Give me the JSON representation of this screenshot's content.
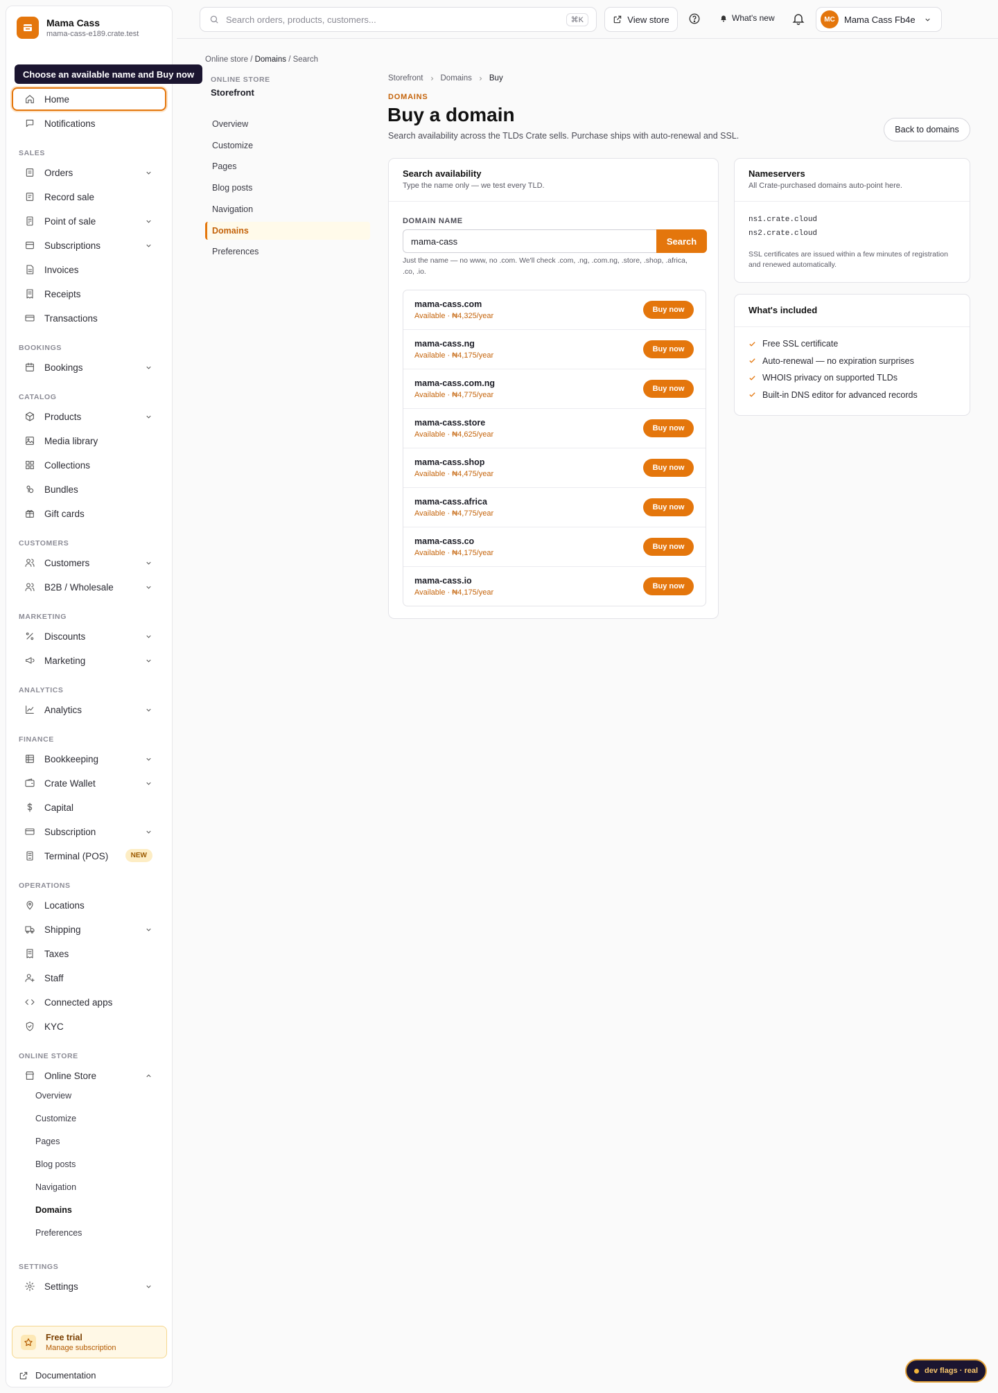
{
  "brand": {
    "name": "Mama Cass",
    "url": "mama-cass-e189.crate.test"
  },
  "tooltip": "Choose an available name and Buy now",
  "sidebar": {
    "top_items": [
      {
        "label": "Home",
        "icon": "home-icon"
      },
      {
        "label": "Notifications",
        "icon": "chat-bubble-icon"
      }
    ],
    "sections": [
      {
        "title": "SALES",
        "items": [
          {
            "label": "Orders",
            "icon": "orders-icon",
            "chevron": true
          },
          {
            "label": "Record sale",
            "icon": "record-sale-icon",
            "chevron": false
          },
          {
            "label": "Point of sale",
            "icon": "pos-icon",
            "chevron": true
          },
          {
            "label": "Subscriptions",
            "icon": "subscriptions-icon",
            "chevron": true
          },
          {
            "label": "Invoices",
            "icon": "invoice-icon",
            "chevron": false
          },
          {
            "label": "Receipts",
            "icon": "receipt-icon",
            "chevron": false
          },
          {
            "label": "Transactions",
            "icon": "card-icon",
            "chevron": false
          }
        ]
      },
      {
        "title": "BOOKINGS",
        "items": [
          {
            "label": "Bookings",
            "icon": "calendar-icon",
            "chevron": true
          }
        ]
      },
      {
        "title": "CATALOG",
        "items": [
          {
            "label": "Products",
            "icon": "box-icon",
            "chevron": true
          },
          {
            "label": "Media library",
            "icon": "image-icon",
            "chevron": false
          },
          {
            "label": "Collections",
            "icon": "grid-icon",
            "chevron": false
          },
          {
            "label": "Bundles",
            "icon": "bundle-icon",
            "chevron": false
          },
          {
            "label": "Gift cards",
            "icon": "gift-icon",
            "chevron": false
          }
        ]
      },
      {
        "title": "CUSTOMERS",
        "items": [
          {
            "label": "Customers",
            "icon": "users-icon",
            "chevron": true
          },
          {
            "label": "B2B / Wholesale",
            "icon": "users-icon",
            "chevron": true
          }
        ]
      },
      {
        "title": "MARKETING",
        "items": [
          {
            "label": "Discounts",
            "icon": "discount-icon",
            "chevron": true
          },
          {
            "label": "Marketing",
            "icon": "megaphone-icon",
            "chevron": true
          }
        ]
      },
      {
        "title": "ANALYTICS",
        "items": [
          {
            "label": "Analytics",
            "icon": "chart-icon",
            "chevron": true
          }
        ]
      },
      {
        "title": "FINANCE",
        "items": [
          {
            "label": "Bookkeeping",
            "icon": "ledger-icon",
            "chevron": true
          },
          {
            "label": "Crate Wallet",
            "icon": "wallet-icon",
            "chevron": true
          },
          {
            "label": "Capital",
            "icon": "dollar-icon",
            "chevron": false
          },
          {
            "label": "Subscription",
            "icon": "card-icon",
            "chevron": true
          },
          {
            "label": "Terminal (POS)",
            "icon": "terminal-icon",
            "chevron": false,
            "badge": "NEW"
          }
        ]
      },
      {
        "title": "OPERATIONS",
        "items": [
          {
            "label": "Locations",
            "icon": "pin-icon",
            "chevron": false
          },
          {
            "label": "Shipping",
            "icon": "truck-icon",
            "chevron": true
          },
          {
            "label": "Taxes",
            "icon": "receipt-icon",
            "chevron": false
          },
          {
            "label": "Staff",
            "icon": "user-plus-icon",
            "chevron": false
          },
          {
            "label": "Connected apps",
            "icon": "code-icon",
            "chevron": false
          },
          {
            "label": "KYC",
            "icon": "shield-check-icon",
            "chevron": false
          }
        ]
      },
      {
        "title": "ONLINE STORE",
        "items": [
          {
            "label": "Online Store",
            "icon": "store-icon",
            "chevron": true,
            "expanded": true
          }
        ]
      }
    ],
    "online_store_sub": [
      "Overview",
      "Customize",
      "Pages",
      "Blog posts",
      "Navigation",
      "Domains",
      "Preferences"
    ],
    "online_store_selected": "Domains",
    "settings_section": "SETTINGS",
    "settings_item": "Settings",
    "trial": {
      "title": "Free trial",
      "subtitle": "Manage subscription"
    },
    "documentation": "Documentation"
  },
  "topbar": {
    "search_placeholder": "Search orders, products, customers...",
    "shortcut": "⌘K",
    "view_store": "View store",
    "whats_new": "What's new",
    "account_initials": "MC",
    "account_name": "Mama Cass Fb4e"
  },
  "breadcrumb_top": {
    "a": "Online store",
    "b": "Domains",
    "c": "Search"
  },
  "subnav": {
    "eyebrow": "ONLINE STORE",
    "title": "Storefront",
    "items": [
      "Overview",
      "Customize",
      "Pages",
      "Blog posts",
      "Navigation",
      "Domains",
      "Preferences"
    ],
    "selected": "Domains"
  },
  "main": {
    "crumbs": [
      "Storefront",
      "Domains",
      "Buy"
    ],
    "eyebrow": "DOMAINS",
    "title": "Buy a domain",
    "description": "Search availability across the TLDs Crate sells. Purchase ships with auto-renewal and SSL.",
    "back_button": "Back to domains"
  },
  "search_card": {
    "title": "Search availability",
    "subtitle": "Type the name only — we test every TLD.",
    "field_label": "DOMAIN NAME",
    "field_value": "mama-cass",
    "button": "Search",
    "hint": "Just the name — no www, no .com. We'll check .com, .ng, .com.ng, .store, .shop, .africa, .co, .io.",
    "buy_label": "Buy now",
    "results": [
      {
        "domain": "mama-cass.com",
        "status": "Available · ₦4,325/year"
      },
      {
        "domain": "mama-cass.ng",
        "status": "Available · ₦4,175/year"
      },
      {
        "domain": "mama-cass.com.ng",
        "status": "Available · ₦4,775/year"
      },
      {
        "domain": "mama-cass.store",
        "status": "Available · ₦4,625/year"
      },
      {
        "domain": "mama-cass.shop",
        "status": "Available · ₦4,475/year"
      },
      {
        "domain": "mama-cass.africa",
        "status": "Available · ₦4,775/year"
      },
      {
        "domain": "mama-cass.co",
        "status": "Available · ₦4,175/year"
      },
      {
        "domain": "mama-cass.io",
        "status": "Available · ₦4,175/year"
      }
    ]
  },
  "nameservers": {
    "title": "Nameservers",
    "subtitle": "All Crate-purchased domains auto-point here.",
    "ns1": "ns1.crate.cloud",
    "ns2": "ns2.crate.cloud",
    "note": "SSL certificates are issued within a few minutes of registration and renewed automatically."
  },
  "included": {
    "title": "What's included",
    "items": [
      "Free SSL certificate",
      "Auto-renewal — no expiration surprises",
      "WHOIS privacy on supported TLDs",
      "Built-in DNS editor for advanced records"
    ]
  },
  "dev_flags": "dev flags · real",
  "colors": {
    "accent": "#e4760c",
    "tooltip_bg": "#1b1530",
    "available_text": "#c4630a"
  }
}
